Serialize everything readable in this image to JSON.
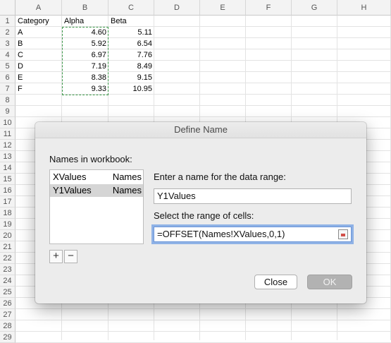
{
  "sheet": {
    "columns": [
      "A",
      "B",
      "C",
      "D",
      "E",
      "F",
      "G",
      "H"
    ],
    "rows": [
      "1",
      "2",
      "3",
      "4",
      "5",
      "6",
      "7",
      "8",
      "9",
      "10",
      "11",
      "12",
      "13",
      "14",
      "15",
      "16",
      "17",
      "18",
      "19",
      "20",
      "21",
      "22",
      "23",
      "24",
      "25",
      "26",
      "27",
      "28",
      "29"
    ],
    "cells": {
      "header": [
        "Category",
        "Alpha",
        "Beta"
      ],
      "data": [
        [
          "A",
          "4.60",
          "5.11"
        ],
        [
          "B",
          "5.92",
          "6.54"
        ],
        [
          "C",
          "6.97",
          "7.76"
        ],
        [
          "D",
          "7.19",
          "8.49"
        ],
        [
          "E",
          "8.38",
          "9.15"
        ],
        [
          "F",
          "9.33",
          "10.95"
        ]
      ]
    }
  },
  "dialog": {
    "title": "Define Name",
    "names_label": "Names in workbook:",
    "names": [
      {
        "name": "XValues",
        "sheet": "Names",
        "selected": false
      },
      {
        "name": "Y1Values",
        "sheet": "Names",
        "selected": true
      }
    ],
    "add_label": "+",
    "remove_label": "−",
    "name_prompt": "Enter a name for the data range:",
    "name_value": "Y1Values",
    "range_prompt": "Select the range of cells:",
    "range_value": "=OFFSET(Names!XValues,0,1)",
    "close_label": "Close",
    "ok_label": "OK"
  },
  "colors": {
    "marquee": "#3d9a4a",
    "focus_ring": "#8fb2e6"
  }
}
